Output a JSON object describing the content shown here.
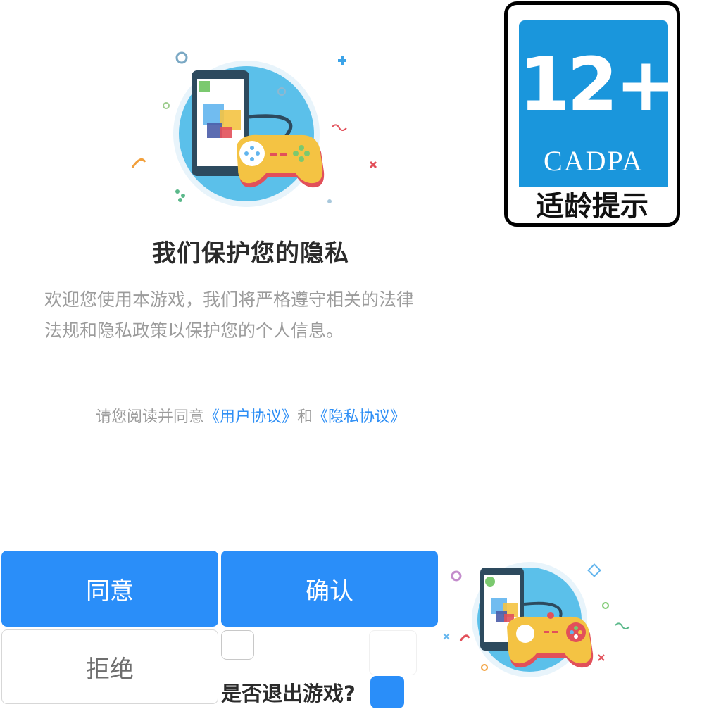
{
  "privacy": {
    "title": "我们保护您的隐私",
    "intro_line1": "欢迎您使用本游戏，我们将严格遵守相关的法律",
    "intro_line2": "法规和隐私政策以保护您的个人信息。",
    "agreement_prefix": "请您阅读并同意",
    "user_agreement_link": "《用户协议》",
    "agreement_and": "和",
    "privacy_agreement_link": "《隐私协议》"
  },
  "age_badge": {
    "rating": "12+",
    "org": "CADPA",
    "label": "适龄提示"
  },
  "buttons": {
    "agree": "同意",
    "confirm": "确认",
    "refuse": "拒绝"
  },
  "exit_prompt": {
    "question": "是否退出游戏?"
  },
  "colors": {
    "primary": "#2a8ef9",
    "link": "#2f8ff5",
    "badge_blue": "#1a96dc"
  },
  "icons": [
    "phone-gamepad-illustration",
    "age-rating-badge"
  ]
}
